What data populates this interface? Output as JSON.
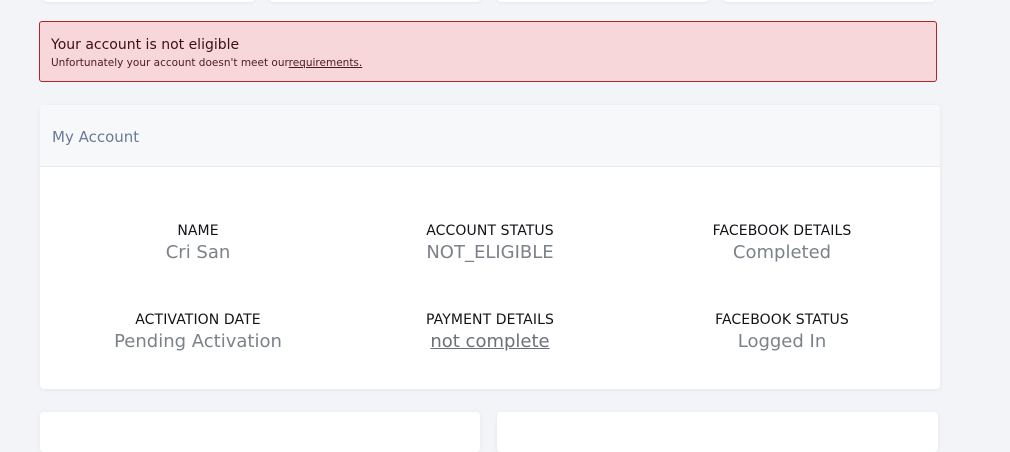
{
  "alert": {
    "title": "Your account is not eligible",
    "text": "Unfortunately your account doesn't meet our",
    "link_text": "requirements."
  },
  "account_card": {
    "title": "My Account",
    "fields": [
      {
        "label": "NAME",
        "value": "Cri San"
      },
      {
        "label": "ACCOUNT STATUS",
        "value": "NOT_ELIGIBLE"
      },
      {
        "label": "FACEBOOK DETAILS",
        "value": "Completed"
      },
      {
        "label": "ACTIVATION DATE",
        "value": "Pending Activation"
      },
      {
        "label": "PAYMENT DETAILS",
        "value": "not complete"
      },
      {
        "label": "FACEBOOK STATUS",
        "value": "Logged In"
      }
    ]
  },
  "colors": {
    "alert_background": "#f8d7da",
    "alert_border": "#b3232e",
    "card_title": "#6b7a99",
    "value_text": "#7c8289"
  }
}
